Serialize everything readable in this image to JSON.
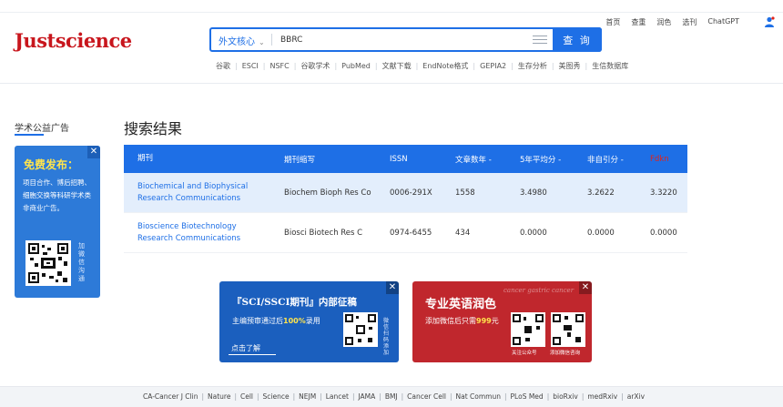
{
  "header": {
    "logo": "Justscience",
    "search": {
      "scope": "外文核心",
      "query": "BBRC",
      "button_label": "查 询"
    },
    "quick_links": [
      "谷歌",
      "ESCI",
      "NSFC",
      "谷歌学术",
      "PubMed",
      "文献下载",
      "EndNote格式",
      "GEPIA2",
      "生存分析",
      "美图秀",
      "生信数据库"
    ],
    "top_nav": [
      "首页",
      "查重",
      "润色",
      "选刊",
      "ChatGPT"
    ]
  },
  "sidebar": {
    "title": "学术公益广告",
    "ad": {
      "headline": "免费发布：",
      "body": "项目合作、博后招聘、细胞交换等科研学术类非商业广告。",
      "qr_caption": "加微信沟通",
      "close": "✕"
    }
  },
  "results": {
    "title": "搜索结果",
    "columns": [
      "期刊",
      "期刊缩写",
      "ISSN",
      "文章数年 -",
      "5年平均分 -",
      "非自引分 -",
      "Fdkn"
    ],
    "rows": [
      {
        "journal": "Biochemical and Biophysical Research Communications",
        "abbr": "Biochem Bioph Res Co",
        "issn": "0006-291X",
        "count": "1558",
        "avg5": "3.4980",
        "nonself": "3.2622",
        "if": "3.3220"
      },
      {
        "journal": "Bioscience Biotechnology Research Communications",
        "abbr": "Biosci Biotech Res C",
        "issn": "0974-6455",
        "count": "434",
        "avg5": "0.0000",
        "nonself": "0.0000",
        "if": "0.0000"
      }
    ]
  },
  "banners": [
    {
      "title": "『SCI/SSCI期刊』内部征稿",
      "subtitle_pre": "主编预审通过后",
      "subtitle_highlight": "100%",
      "subtitle_post": "录用",
      "cta": "点击了解",
      "qr_caption": "微信扫码添加",
      "close": "✕"
    },
    {
      "title": "专业英语润色",
      "subtitle_pre": "添加微信后只需",
      "subtitle_highlight": "999",
      "subtitle_post": "元",
      "deco": "cancer gastric cancer",
      "qr1_caption": "关注公众号",
      "qr2_caption": "添加微信咨询",
      "close": "✕"
    }
  ],
  "footer": {
    "links": [
      "CA-Cancer J Clin",
      "Nature",
      "Cell",
      "Science",
      "NEJM",
      "Lancet",
      "JAMA",
      "BMJ",
      "Cancer Cell",
      "Nat Commun",
      "PLoS Med",
      "bioRxiv",
      "medRxiv",
      "arXiv"
    ]
  },
  "colors": {
    "brand": "#c8161d",
    "accent": "#1e6fe6",
    "banner_red": "#c0272d"
  }
}
